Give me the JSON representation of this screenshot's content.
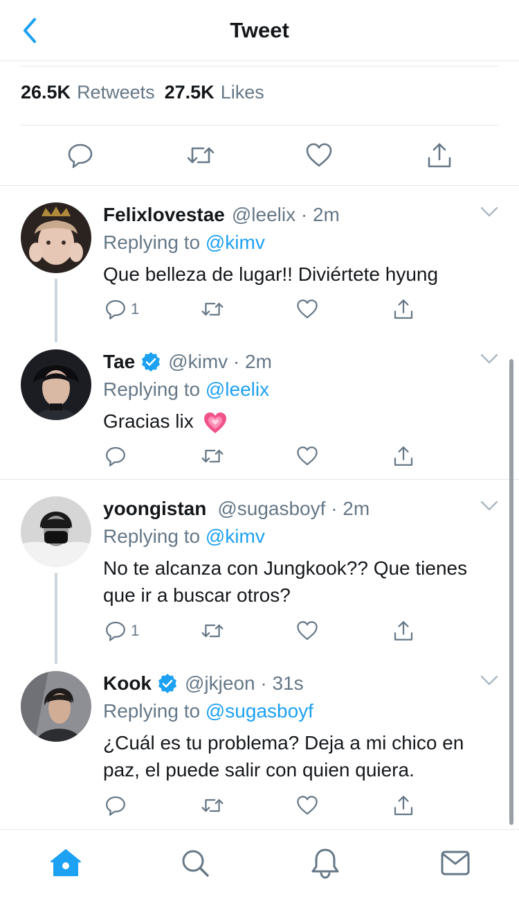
{
  "header": {
    "title": "Tweet",
    "back_icon": "chevron-left-icon"
  },
  "stats": {
    "retweets_count": "26.5K",
    "retweets_label": "Retweets",
    "likes_count": "27.5K",
    "likes_label": "Likes"
  },
  "colors": {
    "accent": "#1da1f2",
    "secondary_text": "#657786",
    "divider": "#e1e8ed",
    "thread_line": "#ccd6dd"
  },
  "replies": [
    {
      "name": "Felixlovestae",
      "handle": "@leelix · 2m",
      "verified": false,
      "replying_prefix": "Replying to",
      "replying_to": "@kimv",
      "text": "Que belleza de lugar!! Diviértete hyung",
      "reply_count": "1"
    },
    {
      "name": "Tae",
      "handle": "@kimv · 2m",
      "verified": true,
      "replying_prefix": "Replying to",
      "replying_to": "@leelix",
      "text": "Gracias lix",
      "emoji": "growing-heart-emoji",
      "reply_count": ""
    },
    {
      "name": "yoongistan",
      "handle": "@sugasboyf · 2m",
      "verified": false,
      "replying_prefix": "Replying to",
      "replying_to": "@kimv",
      "text_line1": "No te alcanza con Jungkook?? Que tienes",
      "text_line2": "que ir a buscar otros?",
      "reply_count": "1"
    },
    {
      "name": "Kook",
      "handle": "@jkjeon · 31s",
      "verified": true,
      "replying_prefix": "Replying to",
      "replying_to": "@sugasboyf",
      "text_line1": "¿Cuál es tu problema? Deja a mi chico en",
      "text_line2": "paz, el puede salir con quien quiera.",
      "reply_count": ""
    }
  ],
  "tabbar": {
    "items": [
      "home-icon",
      "search-icon",
      "notifications-bell-icon",
      "messages-envelope-icon"
    ],
    "active": "home-icon"
  }
}
